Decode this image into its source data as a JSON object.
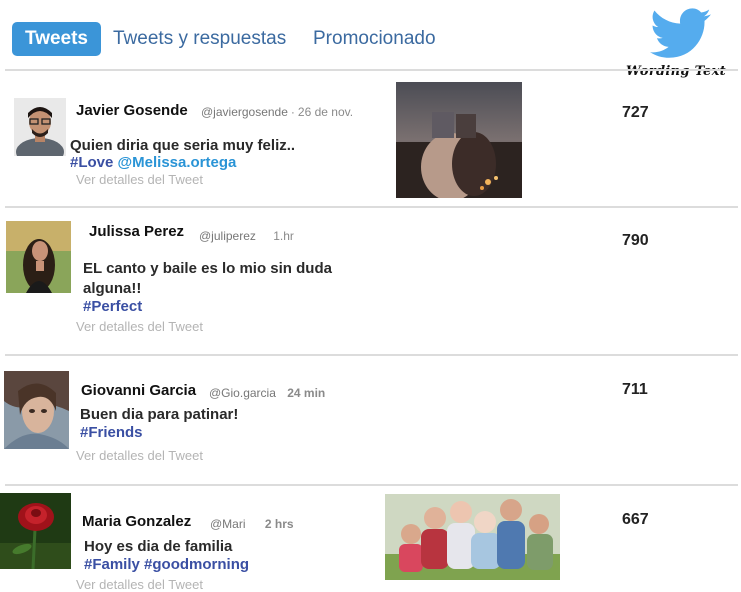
{
  "tabs": [
    {
      "label": "Tweets",
      "active": true
    },
    {
      "label": "Tweets y respuestas",
      "active": false
    },
    {
      "label": "Promocionado",
      "active": false
    }
  ],
  "logo": {
    "icon": "twitter-bird-icon",
    "text": "Wording Text",
    "color": "#55acee"
  },
  "tweets": [
    {
      "name": "Javier Gosende",
      "handle": "@javiergosende",
      "separator": "·",
      "time": "26 de nov.",
      "text": "Quien diria que seria muy feliz..",
      "hashtag": "#Love",
      "mention": "@Melissa.ortega",
      "details": "Ver detalles del Tweet",
      "count": "727"
    },
    {
      "name": "Julissa Perez",
      "handle": "@juliperez",
      "time": "1.hr",
      "text": "EL canto y baile es lo mio sin duda alguna!!",
      "hashtag": "#Perfect",
      "details": "Ver detalles del Tweet",
      "count": "790"
    },
    {
      "name": "Giovanni Garcia",
      "handle": "@Gio.garcia",
      "time": "24 min",
      "text": "Buen dia para patinar!",
      "hashtag": "#Friends",
      "details": "Ver detalles del Tweet",
      "count": "711"
    },
    {
      "name": "Maria Gonzalez",
      "handle": "@Mari",
      "time": "2 hrs",
      "text": "Hoy es dia de familia",
      "hashtag": "#Family #goodmorning",
      "details": "Ver detalles del Tweet",
      "count": "667"
    }
  ],
  "colors": {
    "tab_active_bg": "#3b95d8",
    "link": "#3b6aa0",
    "hashtag": "#3a4fa3",
    "mention": "#2a94d6"
  }
}
